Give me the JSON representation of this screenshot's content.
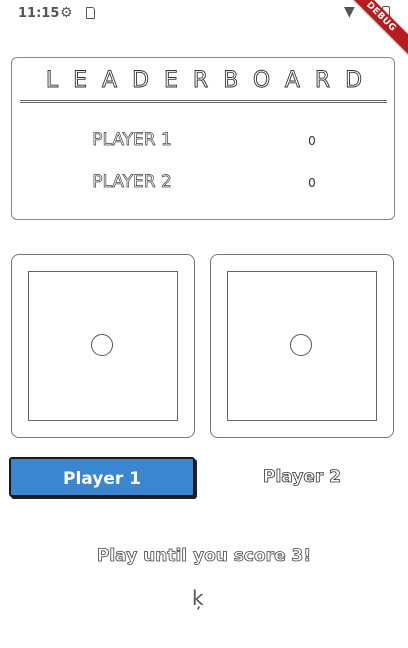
{
  "status_bar": {
    "time": "11:15",
    "settings_icon": "gear-icon",
    "sd_icon": "sd-card-icon",
    "wifi_icon": "wifi-icon",
    "battery_icon": "battery-icon",
    "debug_label": "DEBUG"
  },
  "leaderboard": {
    "title": "LEADERBOARD",
    "rows": [
      {
        "name": "PLAYER 1",
        "score": "0"
      },
      {
        "name": "PLAYER 2",
        "score": "0"
      }
    ]
  },
  "dice": [
    {
      "label": "left-die",
      "pips": 1
    },
    {
      "label": "right-die",
      "pips": 1
    }
  ],
  "players": {
    "player1_label": "Player 1",
    "player2_label": "Player 2",
    "active_player": "Player 1",
    "active_color": "#3a86d0"
  },
  "instruction": "Play until you score 3!",
  "cursor_glyph": "ķ"
}
